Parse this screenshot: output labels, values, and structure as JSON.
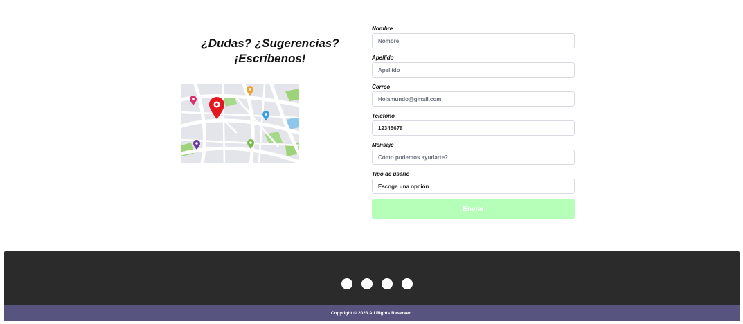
{
  "heading": {
    "line1": "¿Dudas? ¿Sugerencias?",
    "line2": "¡Escríbenos!"
  },
  "map_image": {
    "icon": "map-with-pins-icon",
    "pin_colors": [
      "#e3191f",
      "#d6336c",
      "#f0a030",
      "#3aa0e0",
      "#6a3a9a",
      "#7ab648"
    ]
  },
  "form": {
    "nombre": {
      "label": "Nombre",
      "placeholder": "Nombre"
    },
    "apellido": {
      "label": "Apellido",
      "placeholder": "Apellido"
    },
    "correo": {
      "label": "Correo",
      "placeholder": "Holamundo@gmail.com"
    },
    "telefono": {
      "label": "Telefono",
      "placeholder": "12345678"
    },
    "mensaje": {
      "label": "Mensaje",
      "placeholder": "Cómo podemos ayudarte?"
    },
    "tipo_usuario": {
      "label": "Tipo de usario",
      "selected": "Escoge una opción"
    },
    "submit_label": "Enviar"
  },
  "colors": {
    "submit": "#b6ffb8",
    "footer": "#2b2b2b",
    "copyright_bar": "#57557f"
  },
  "footer": {
    "social_icons": [
      "social-icon-1",
      "social-icon-2",
      "social-icon-3",
      "social-icon-4"
    ],
    "copyright": "Copyright © 2023 All Rights Reserved."
  }
}
